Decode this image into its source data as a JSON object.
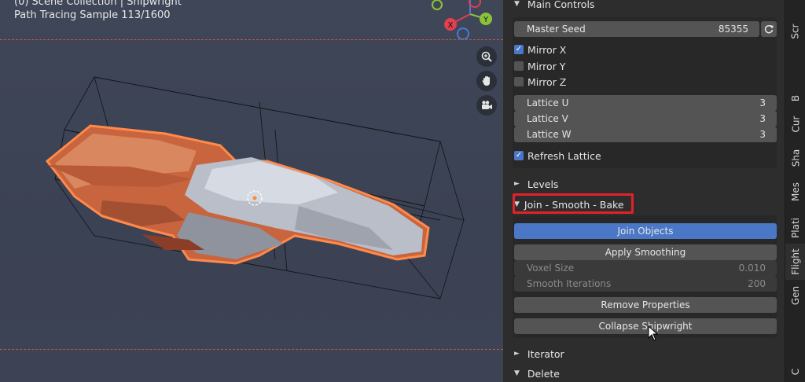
{
  "viewport": {
    "line1": "(0) Scene Collection | Shipwright",
    "line2": "Path Tracing Sample 113/1600",
    "gizmo": {
      "x_label": "X",
      "y_label": "Y",
      "x_color": "#e0404f",
      "y_color": "#8ac33a",
      "z_color": "#4a78d8"
    },
    "nav_icons": [
      "zoom-icon",
      "hand-icon",
      "camera-icon"
    ]
  },
  "panel": {
    "main_controls": {
      "title": "Main Controls",
      "master_seed": {
        "label": "Master Seed",
        "value": "85355"
      },
      "mirror_x": {
        "label": "Mirror X",
        "checked": true
      },
      "mirror_y": {
        "label": "Mirror Y",
        "checked": false
      },
      "mirror_z": {
        "label": "Mirror Z",
        "checked": false
      },
      "lattice_u": {
        "label": "Lattice U",
        "value": "3"
      },
      "lattice_v": {
        "label": "Lattice V",
        "value": "3"
      },
      "lattice_w": {
        "label": "Lattice W",
        "value": "3"
      },
      "refresh_lattice": {
        "label": "Refresh Lattice",
        "checked": true
      }
    },
    "levels": {
      "title": "Levels"
    },
    "join_smooth_bake": {
      "title": "Join - Smooth - Bake",
      "join_objects": "Join Objects",
      "apply_smoothing": "Apply Smoothing",
      "voxel_size": {
        "label": "Voxel Size",
        "value": "0.010"
      },
      "smooth_iterations": {
        "label": "Smooth Iterations",
        "value": "200"
      },
      "remove_properties": "Remove Properties",
      "collapse_shipwright": "Collapse Shipwright"
    },
    "iterator": {
      "title": "Iterator"
    },
    "delete": {
      "title": "Delete"
    }
  },
  "tabs": [
    "Scr",
    "B",
    "Cur",
    "Sha",
    "Mes",
    "Plati",
    "Flight",
    "Gen",
    "C"
  ],
  "colors": {
    "accent_blue": "#4a77c6",
    "highlight_red": "#e0232a",
    "selection_orange": "#e07a45"
  }
}
